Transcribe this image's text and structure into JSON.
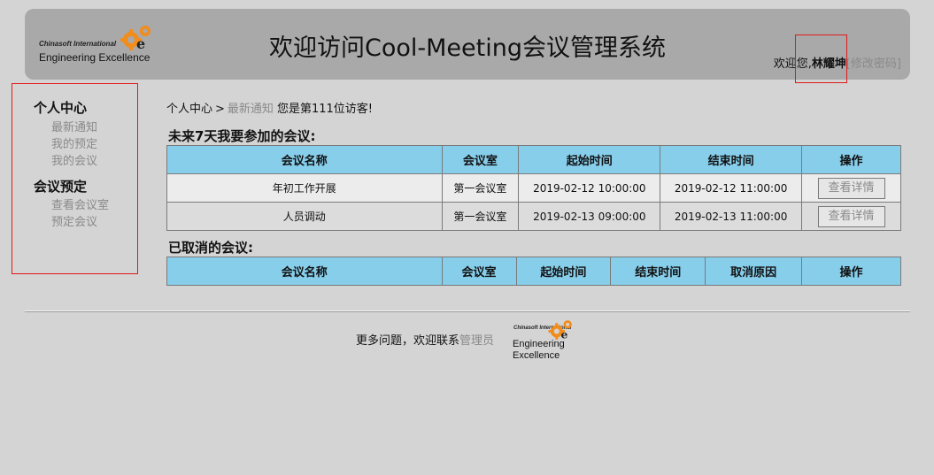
{
  "header": {
    "logo_line1": "Chinasoft International",
    "logo_line2": "Engineering Excellence",
    "title": "欢迎访问Cool-Meeting会议管理系统",
    "welcome": "欢迎您,",
    "username": "林耀坤",
    "change_password": "[修改密码]"
  },
  "sidebar": {
    "groups": [
      {
        "label": "个人中心",
        "items": [
          "最新通知",
          "我的预定",
          "我的会议"
        ]
      },
      {
        "label": "会议预定",
        "items": [
          "查看会议室",
          "预定会议"
        ]
      }
    ]
  },
  "breadcrumb": {
    "home": "个人中心",
    "separator": ">",
    "current": "最新通知",
    "visitor_text": "您是第111位访客!"
  },
  "upcoming": {
    "title": "未来7天我要参加的会议:",
    "columns": [
      "会议名称",
      "会议室",
      "起始时间",
      "结束时间",
      "操作"
    ],
    "rows": [
      {
        "name": "年初工作开展",
        "room": "第一会议室",
        "start": "2019-02-12 10:00:00",
        "end": "2019-02-12 11:00:00",
        "action": "查看详情"
      },
      {
        "name": "人员调动",
        "room": "第一会议室",
        "start": "2019-02-13 09:00:00",
        "end": "2019-02-13 11:00:00",
        "action": "查看详情"
      }
    ]
  },
  "cancelled": {
    "title": "已取消的会议:",
    "columns": [
      "会议名称",
      "会议室",
      "起始时间",
      "结束时间",
      "取消原因",
      "操作"
    ]
  },
  "footer": {
    "text": "更多问题，欢迎联系",
    "admin_link": "管理员",
    "logo_line1": "Chinasoft International",
    "logo_line2": "Engineering Excellence"
  },
  "colors": {
    "background": "#d4d4d4",
    "header_bg": "#a9a9a9",
    "table_header": "#87ceeb",
    "highlight_box": "#e01a1a",
    "muted_link": "#8a8a8a"
  }
}
